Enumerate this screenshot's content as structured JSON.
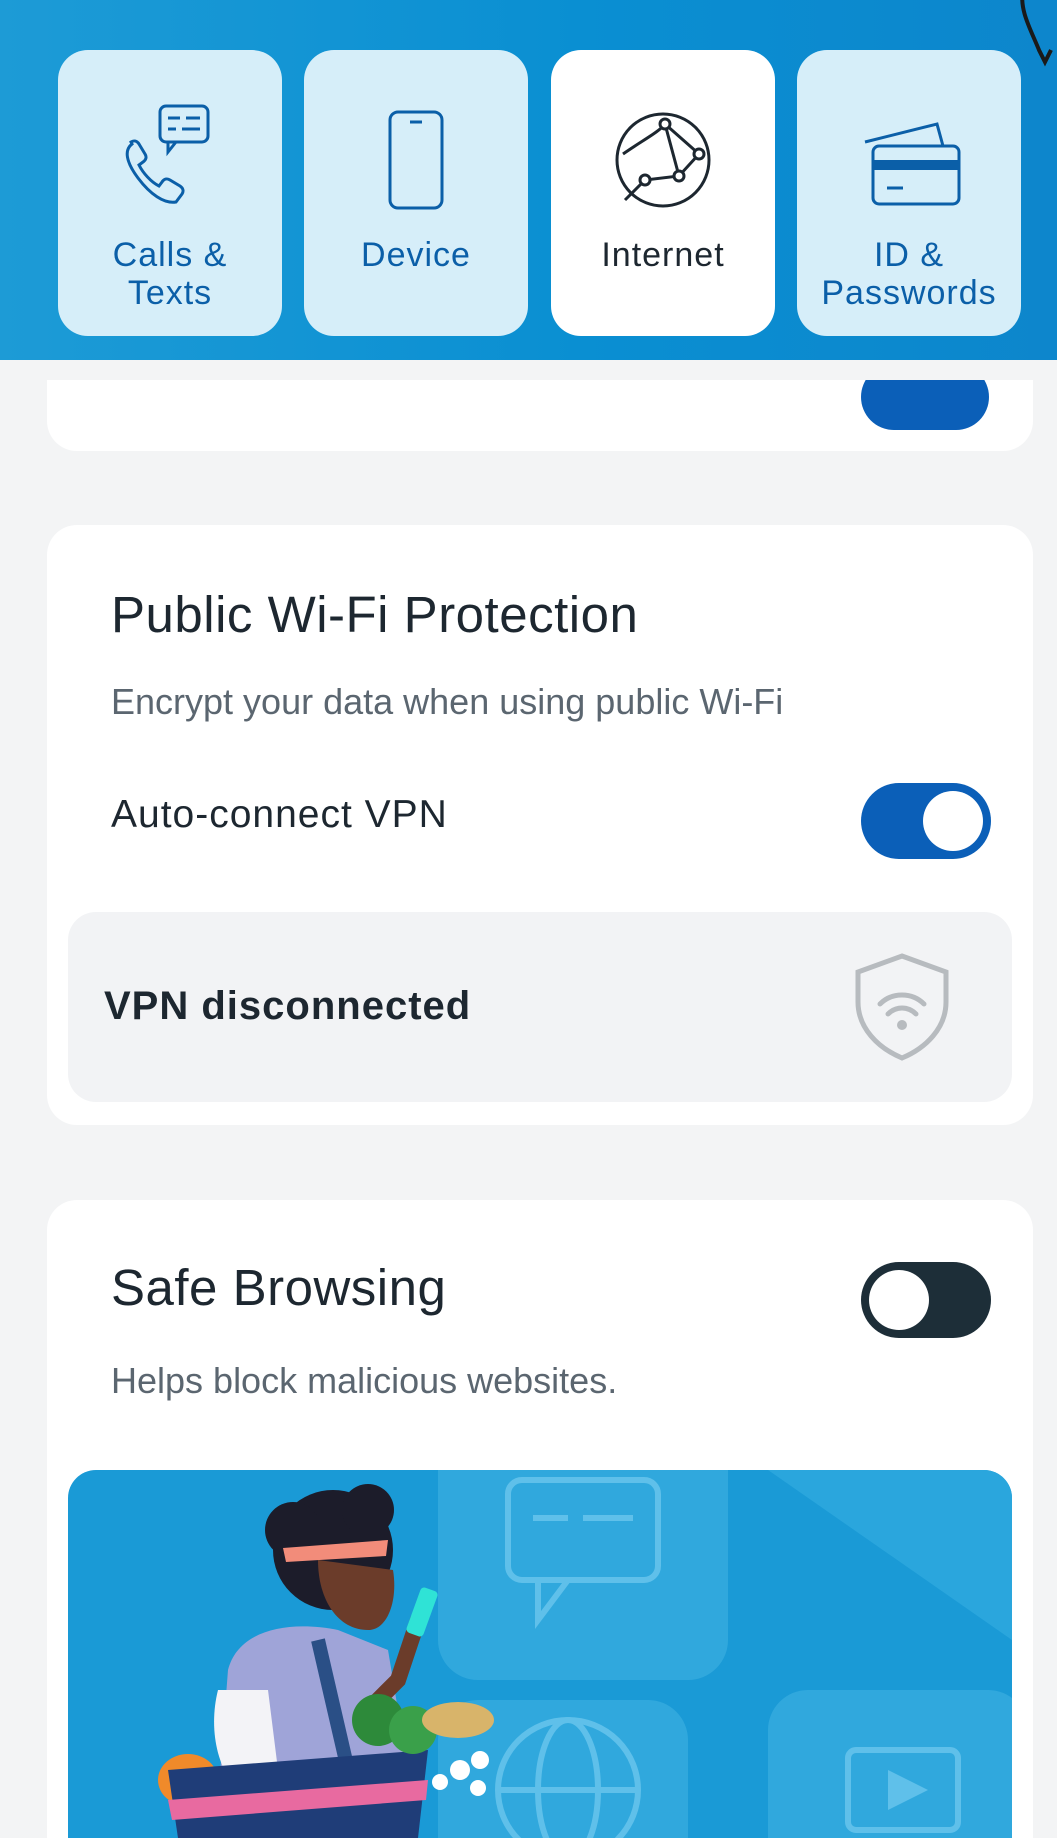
{
  "categories": [
    {
      "label_line1": "Calls &",
      "label_line2": "Texts",
      "icon": "phone-chat-icon",
      "active": false
    },
    {
      "label_line1": "Device",
      "label_line2": "",
      "icon": "smartphone-icon",
      "active": false
    },
    {
      "label_line1": "Internet",
      "label_line2": "",
      "icon": "globe-network-icon",
      "active": true
    },
    {
      "label_line1": "ID &",
      "label_line2": "Passwords",
      "icon": "id-card-icon",
      "active": false
    }
  ],
  "vpn_card": {
    "title": "Public Wi-Fi Protection",
    "description": "Encrypt your data when using public Wi-Fi",
    "autoconnect_label": "Auto-connect VPN",
    "autoconnect_on": true,
    "status_text": "VPN disconnected",
    "status_icon": "wifi-shield-icon"
  },
  "safe_browsing": {
    "title": "Safe Browsing",
    "description": "Helps block malicious websites.",
    "enabled": false
  },
  "colors": {
    "accent": "#0b5fb8",
    "header_blue": "#0a8fd2",
    "tile_bg": "#d6eef9",
    "toggle_off": "#1d2e38"
  }
}
